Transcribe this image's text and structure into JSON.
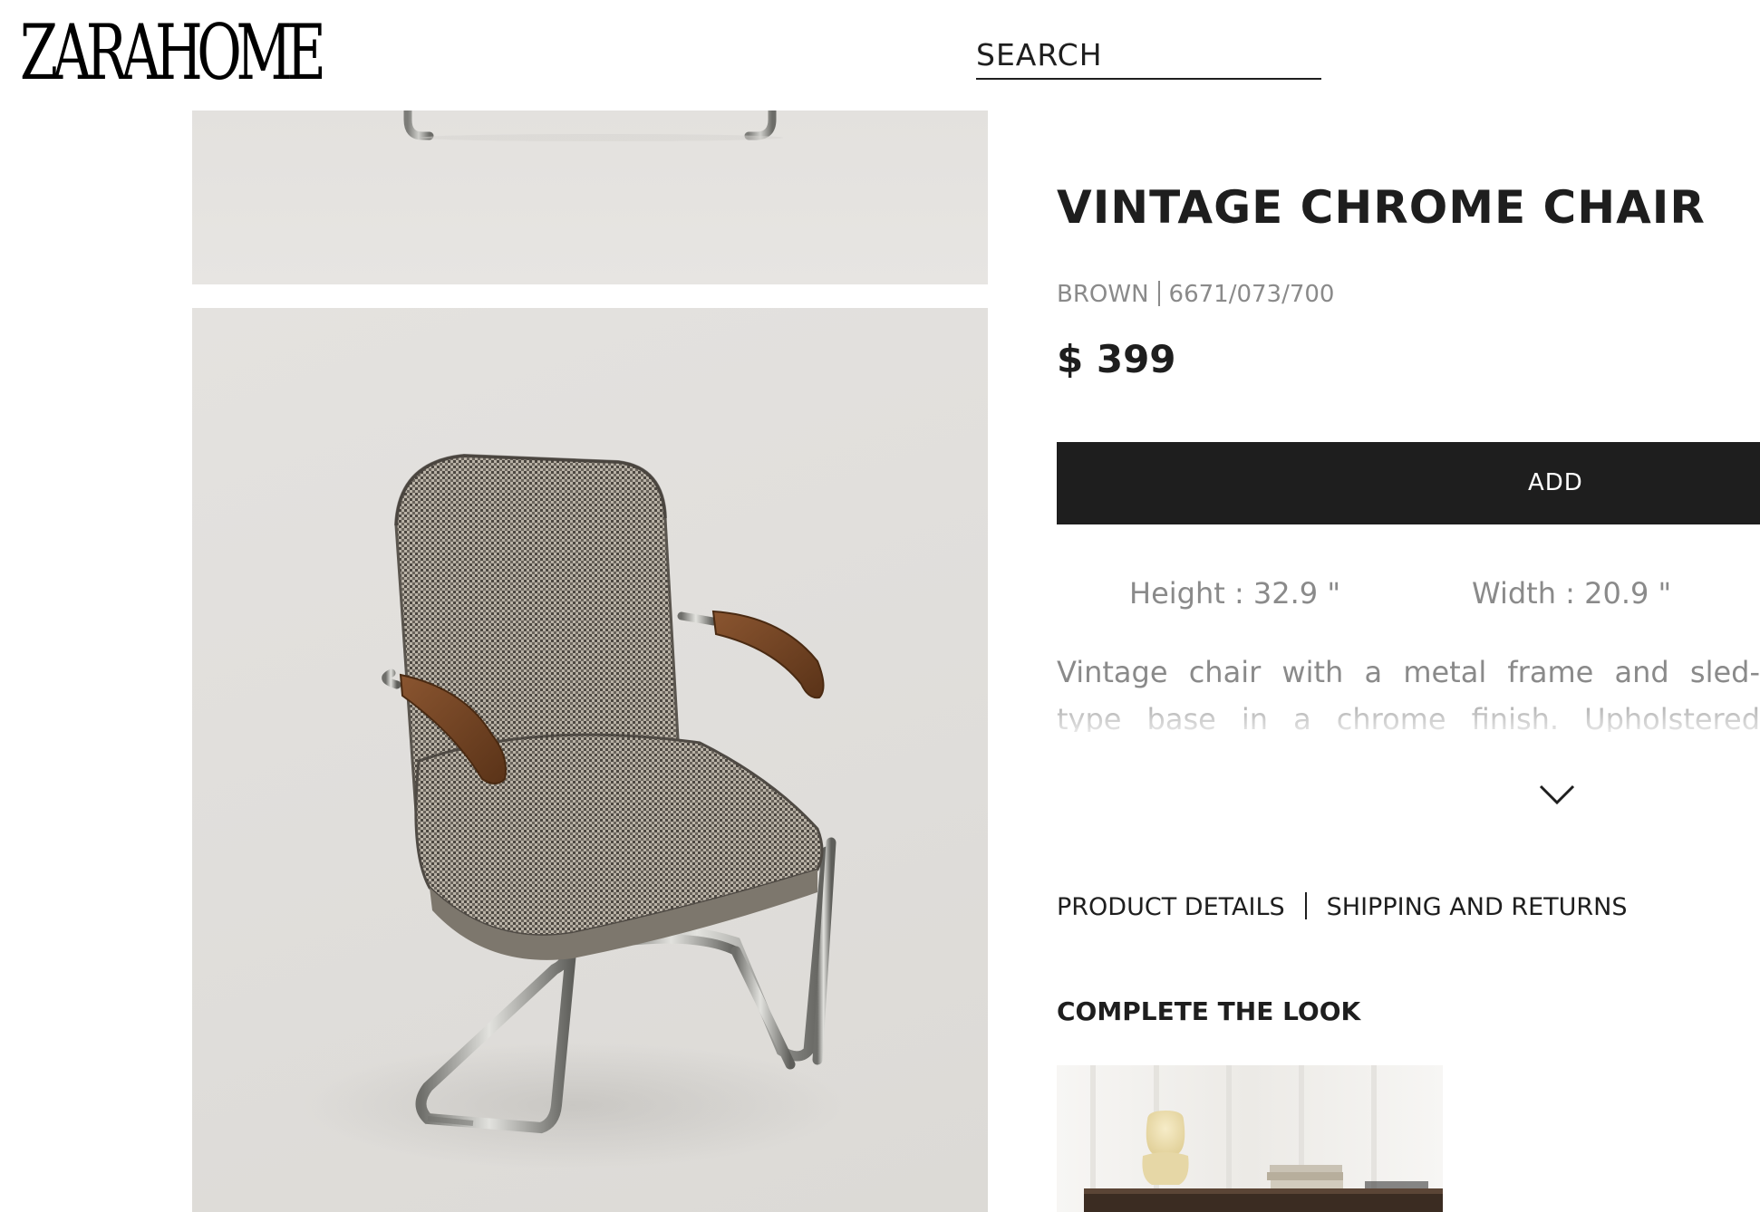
{
  "header": {
    "logo_text": "ZARAHOME",
    "search": {
      "placeholder": "SEARCH",
      "value": ""
    }
  },
  "product": {
    "title": "VINTAGE CHROME CHAIR",
    "color": "BROWN",
    "reference": "6671/073/700",
    "price": "$ 399",
    "add_label": "ADD",
    "dimensions": {
      "height": "Height : 32.9 \"",
      "width": "Width : 20.9 \""
    },
    "description": "Vintage chair with a metal frame and sled-type base in a chrome finish. Upholstered seat and backrest with a houndstooth design and wooden armrests."
  },
  "links": {
    "product_details": "PRODUCT DETAILS",
    "shipping_returns": "SHIPPING AND RETURNS"
  },
  "complete_the_look": {
    "heading": "COMPLETE THE LOOK"
  },
  "icons": {
    "expand": "chevron-down-icon"
  },
  "colors": {
    "primary": "#1e1e1e",
    "muted_text": "#8a8a8a",
    "background": "#ffffff"
  }
}
